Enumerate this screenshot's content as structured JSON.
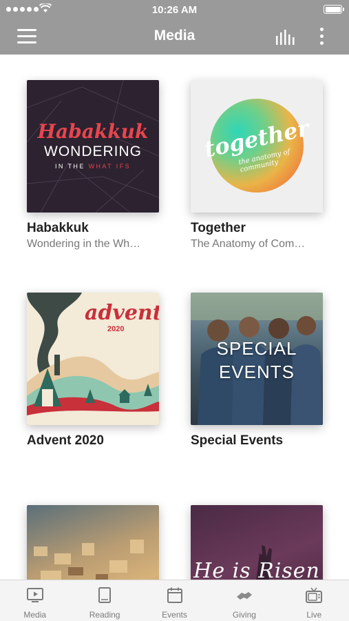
{
  "status": {
    "time": "10:26 AM"
  },
  "nav": {
    "title": "Media"
  },
  "colors": {
    "header": "#9a9a9a",
    "accent_red": "#e8454e",
    "tab_inactive": "#7a7a7a"
  },
  "items": [
    {
      "title": "Habakkuk",
      "subtitle": "Wondering in the Wh…",
      "art": {
        "script": "Habakkuk",
        "headline": "WONDERING",
        "line_a": "IN THE ",
        "line_b": "WHAT IFS"
      }
    },
    {
      "title": "Together",
      "subtitle": "The Anatomy of Com…",
      "art": {
        "script": "together",
        "tagline": "the anatomy of community"
      }
    },
    {
      "title": "Advent 2020",
      "subtitle": "",
      "art": {
        "script": "advent",
        "year": "2020"
      }
    },
    {
      "title": "Special Events",
      "subtitle": "",
      "art": {
        "line1": "SPECIAL",
        "line2": "EVENTS"
      }
    },
    {
      "title": "",
      "subtitle": "",
      "art": {}
    },
    {
      "title": "",
      "subtitle": "",
      "art": {
        "script": "He is Risen"
      }
    }
  ],
  "tabs": [
    {
      "label": "Media",
      "icon": "tv-play-icon"
    },
    {
      "label": "Reading",
      "icon": "book-icon"
    },
    {
      "label": "Events",
      "icon": "calendar-icon"
    },
    {
      "label": "Giving",
      "icon": "handshake-icon"
    },
    {
      "label": "Live",
      "icon": "retro-tv-icon"
    }
  ]
}
